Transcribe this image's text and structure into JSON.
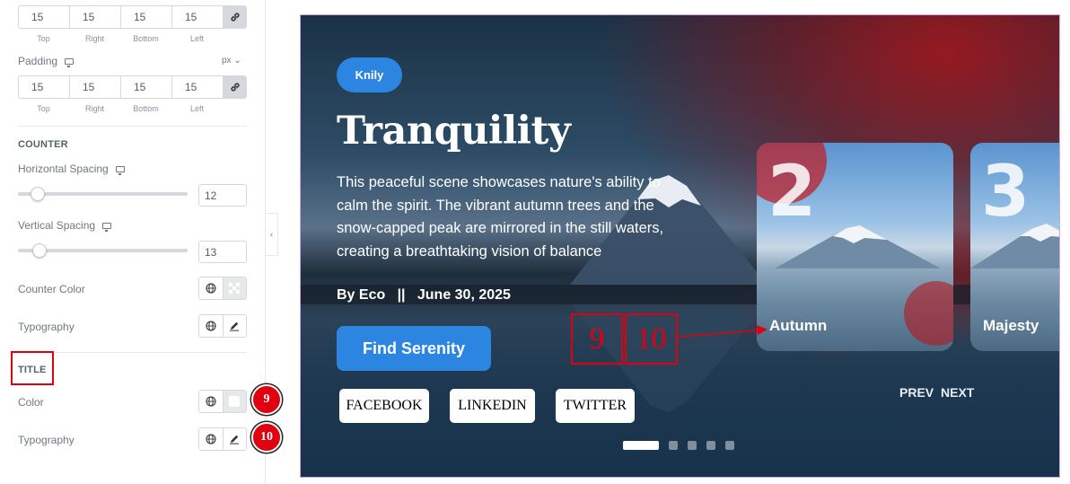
{
  "editor": {
    "margin": {
      "values": [
        "15",
        "15",
        "15",
        "15"
      ],
      "labels": [
        "Top",
        "Right",
        "Bottom",
        "Left"
      ]
    },
    "padding": {
      "label": "Padding",
      "unit": "px",
      "values": [
        "15",
        "15",
        "15",
        "15"
      ],
      "labels": [
        "Top",
        "Right",
        "Bottom",
        "Left"
      ]
    },
    "counter": {
      "section_title": "COUNTER",
      "horizontal_spacing": {
        "label": "Horizontal Spacing",
        "value": "12",
        "level": 0.12
      },
      "vertical_spacing": {
        "label": "Vertical Spacing",
        "value": "13",
        "level": 0.13
      },
      "color_label": "Counter Color",
      "typography_label": "Typography"
    },
    "title_section": {
      "section_title": "TITLE",
      "color_label": "Color",
      "typography_label": "Typography"
    },
    "badges": [
      "9",
      "10"
    ]
  },
  "preview": {
    "tag": "Knily",
    "title": "Tranquility",
    "description": "This peaceful scene showcases nature's ability to calm the spirit. The vibrant autumn trees and the snow-capped peak are mirrored in the still waters, creating a breathtaking vision of balance",
    "meta": "By Eco   ||   June 30, 2025",
    "button": "Find Serenity",
    "social": [
      "FACEBOOK",
      "LINKEDIN",
      "TWITTER"
    ],
    "cards": [
      {
        "number": "2",
        "caption": "Autumn"
      },
      {
        "number": "3",
        "caption": "Majesty"
      }
    ],
    "nav": {
      "prev": "PREV",
      "next": "NEXT"
    },
    "annotations": [
      "9",
      "10"
    ],
    "pagination": {
      "count": 5,
      "active": 1
    }
  },
  "colors": {
    "accent": "#2c85e0",
    "annotation": "#e00010",
    "selection_border": "#cfa6ee"
  }
}
